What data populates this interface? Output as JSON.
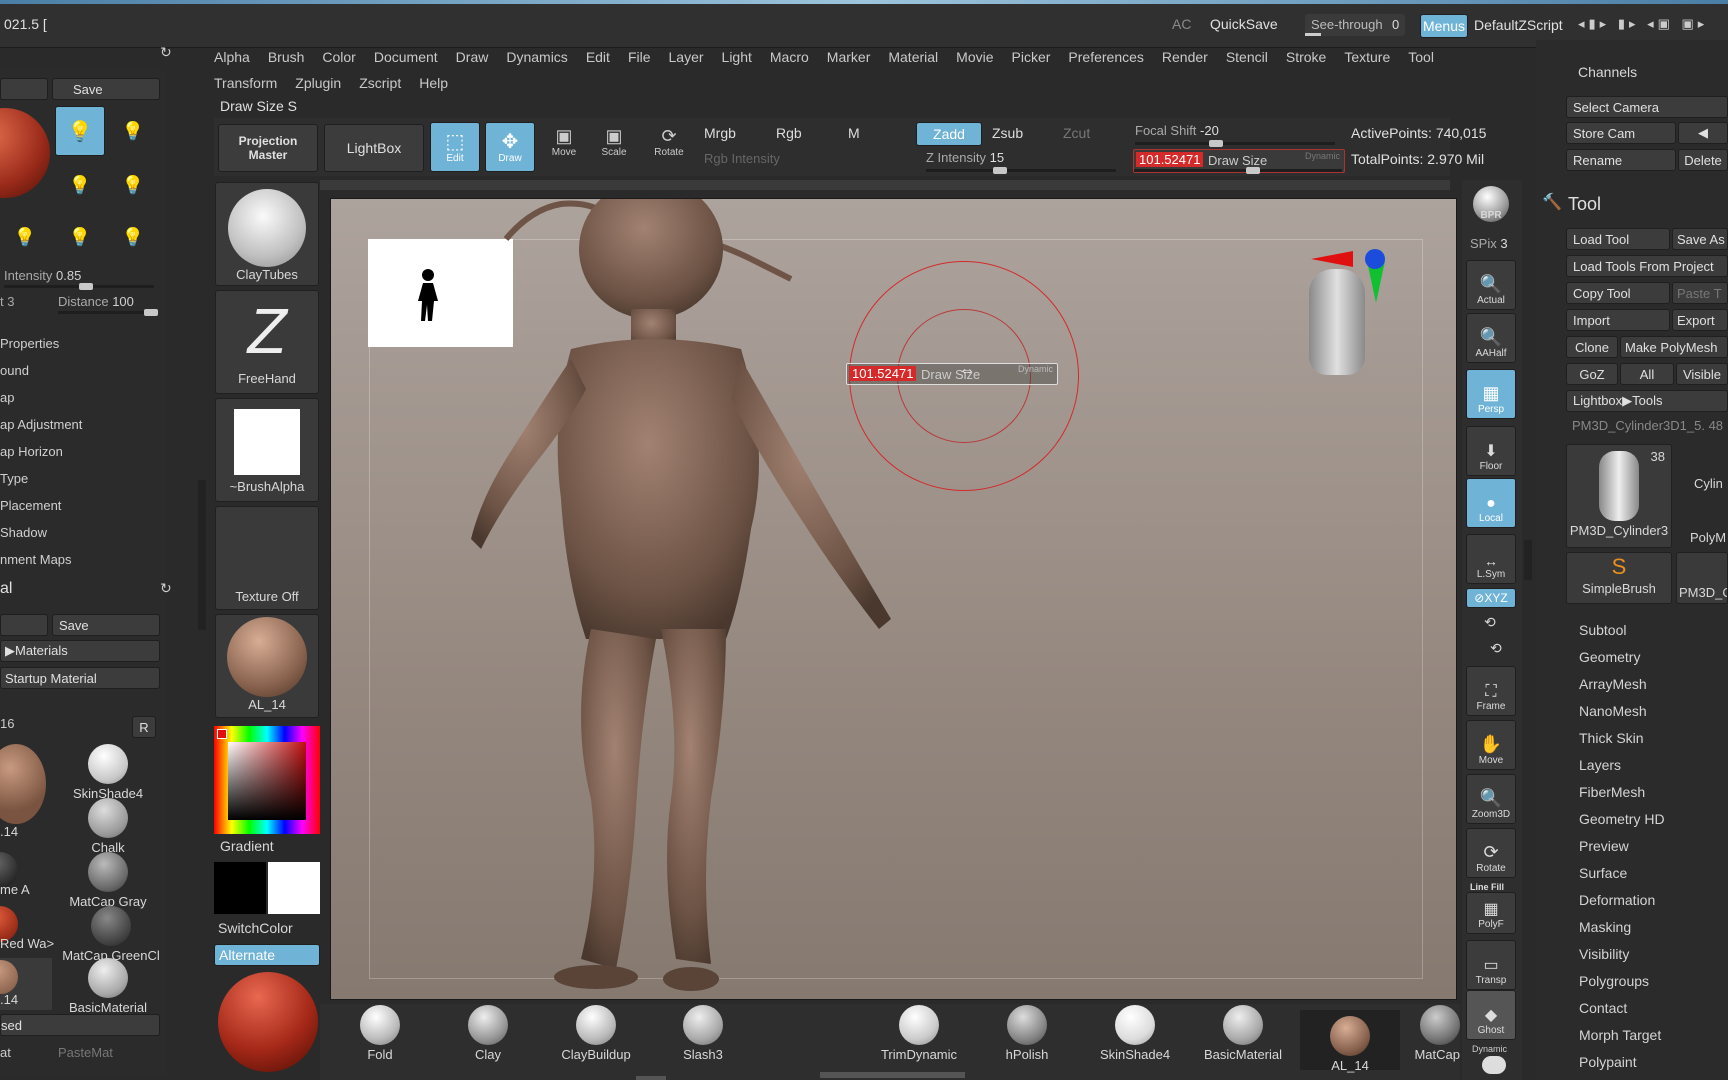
{
  "colors": {
    "accent": "#6fb3d7",
    "highlight": "#d42a2a",
    "viewport_top": "#ada39d",
    "viewport_bottom": "#857970"
  },
  "titlebar": {
    "version": "021.5 [",
    "ac": "AC",
    "quicksave": "QuickSave",
    "see_through_label": "See-through",
    "see_through_value": "0",
    "menus": "Menus",
    "default_script": "DefaultZScript"
  },
  "menu": [
    "Alpha",
    "Brush",
    "Color",
    "Document",
    "Draw",
    "Dynamics",
    "Edit",
    "File",
    "Layer",
    "Light",
    "Macro",
    "Marker",
    "Material",
    "Movie",
    "Picker",
    "Preferences",
    "Render",
    "Stencil",
    "Stroke",
    "Texture",
    "Tool"
  ],
  "submenu": [
    "Transform",
    "Zplugin",
    "Zscript",
    "Help"
  ],
  "status": "Draw Size S",
  "toolbar": {
    "projection_master": "Projection Master",
    "lightbox": "LightBox",
    "edit": "Edit",
    "draw": "Draw",
    "move": "Move",
    "scale": "Scale",
    "rotate": "Rotate",
    "mrgb": "Mrgb",
    "rgb": "Rgb",
    "m": "M",
    "rgb_intensity": "Rgb Intensity",
    "zadd": "Zadd",
    "zsub": "Zsub",
    "zcut": "Zcut",
    "z_intensity_label": "Z Intensity",
    "z_intensity_value": "15",
    "focal_shift_label": "Focal Shift",
    "focal_shift_value": "-20",
    "draw_size_value": "101.52471",
    "draw_size_label": "Draw Size",
    "dynamic": "Dynamic",
    "active_points": "ActivePoints: 740,015",
    "total_points": "TotalPoints: 2.970 Mil"
  },
  "left_panel": {
    "save": "Save",
    "intensity_label": "Intensity",
    "intensity_value": "0.85",
    "three": "t 3",
    "distance_label": "Distance",
    "distance_value": "100",
    "light_props": [
      "Properties",
      "ound",
      "ap",
      "ap Adjustment",
      "ap Horizon",
      "Type",
      "Placement",
      "Shadow",
      "nment Maps"
    ],
    "material_header": "al",
    "save2": "Save",
    "materials": "▶Materials",
    "startup_material": "Startup Material",
    "mat_count": "16",
    "r": "R",
    "mats": [
      "SkinShade4",
      "Chalk",
      "MatCap Gray",
      "MatCap GreenCl",
      "BasicMaterial"
    ],
    "left_mats": [
      ".14",
      "me A",
      "Red Wa>",
      ".14"
    ],
    "sed": "sed",
    "at": "at",
    "pastemat": "PasteMat"
  },
  "brush_column": {
    "claytubes": "ClayTubes",
    "freehand": "FreeHand",
    "brushalpha": "~BrushAlpha",
    "texture_off": "Texture Off",
    "al14": "AL_14",
    "gradient": "Gradient",
    "switchcolor": "SwitchColor",
    "alternate": "Alternate"
  },
  "viewport": {
    "draw_size_value": "101.52471",
    "draw_size_label": "Draw Size",
    "dynamic": "Dynamic"
  },
  "right_toolbar": {
    "bpr": "BPR",
    "spix_label": "SPix",
    "spix_value": "3",
    "actual": "Actual",
    "aahalf": "AAHalf",
    "persp": "Persp",
    "floor": "Floor",
    "local": "Local",
    "lsym": "L.Sym",
    "xyz": "⊘XYZ",
    "frame": "Frame",
    "move": "Move",
    "zoom3d": "Zoom3D",
    "rotate": "Rotate",
    "polyf": "PolyF",
    "line_fill": "Line Fill",
    "transp": "Transp",
    "ghost": "Ghost",
    "dynamic": "Dynamic"
  },
  "right_panel": {
    "channels": "Channels",
    "select_camera": "Select Camera",
    "store_cam": "Store Cam",
    "rename": "Rename",
    "delete": "Delete",
    "tool_header": "Tool",
    "load_tool": "Load Tool",
    "save_as": "Save As",
    "load_from_project": "Load Tools From Project",
    "copy_tool": "Copy Tool",
    "paste_t": "Paste T",
    "import": "Import",
    "export": "Export",
    "clone": "Clone",
    "make_polymesh": "Make PolyMesh",
    "goz": "GoZ",
    "all": "All",
    "visible": "Visible",
    "lightbox_tools": "Lightbox▶Tools",
    "current_tool": "PM3D_Cylinder3D1_5. 48",
    "tool_count": "38",
    "tools": [
      "PM3D_Cylinder3",
      "Cylin",
      "PolyM",
      "SimpleBrush",
      "PM3D_C"
    ],
    "subpalettes": [
      "Subtool",
      "Geometry",
      "ArrayMesh",
      "NanoMesh",
      "Thick Skin",
      "Layers",
      "FiberMesh",
      "Geometry HD",
      "Preview",
      "Surface",
      "Deformation",
      "Masking",
      "Visibility",
      "Polygroups",
      "Contact",
      "Morph Target",
      "Polypaint"
    ]
  },
  "shelf": [
    "Fold",
    "Clay",
    "ClayBuildup",
    "Slash3",
    "TrimDynamic",
    "hPolish",
    "SkinShade4",
    "BasicMaterial",
    "AL_14",
    "MatCap"
  ]
}
